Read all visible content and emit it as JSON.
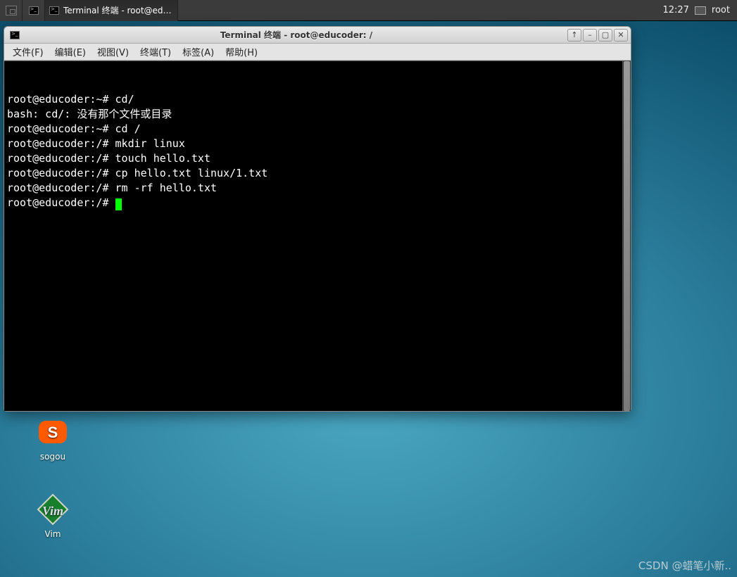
{
  "panel": {
    "taskbar_label": "Terminal 终端 - root@ed…",
    "clock": "12:27",
    "user": "root"
  },
  "window": {
    "title": "Terminal 终端 - root@educoder: /",
    "menu": [
      "文件(F)",
      "编辑(E)",
      "视图(V)",
      "终端(T)",
      "标签(A)",
      "帮助(H)"
    ],
    "btn_up": "↑",
    "btn_min": "–",
    "btn_max": "▢",
    "btn_close": "✕",
    "lines": [
      "root@educoder:~# cd/",
      "bash: cd/: 没有那个文件或目录",
      "root@educoder:~# cd /",
      "root@educoder:/# mkdir linux",
      "root@educoder:/# touch hello.txt",
      "root@educoder:/# cp hello.txt linux/1.txt",
      "root@educoder:/# rm -rf hello.txt",
      "root@educoder:/# "
    ]
  },
  "desktop_icons": {
    "sogou": "sogou",
    "vim": "Vim"
  },
  "watermark": "CSDN @蜡笔小新.."
}
